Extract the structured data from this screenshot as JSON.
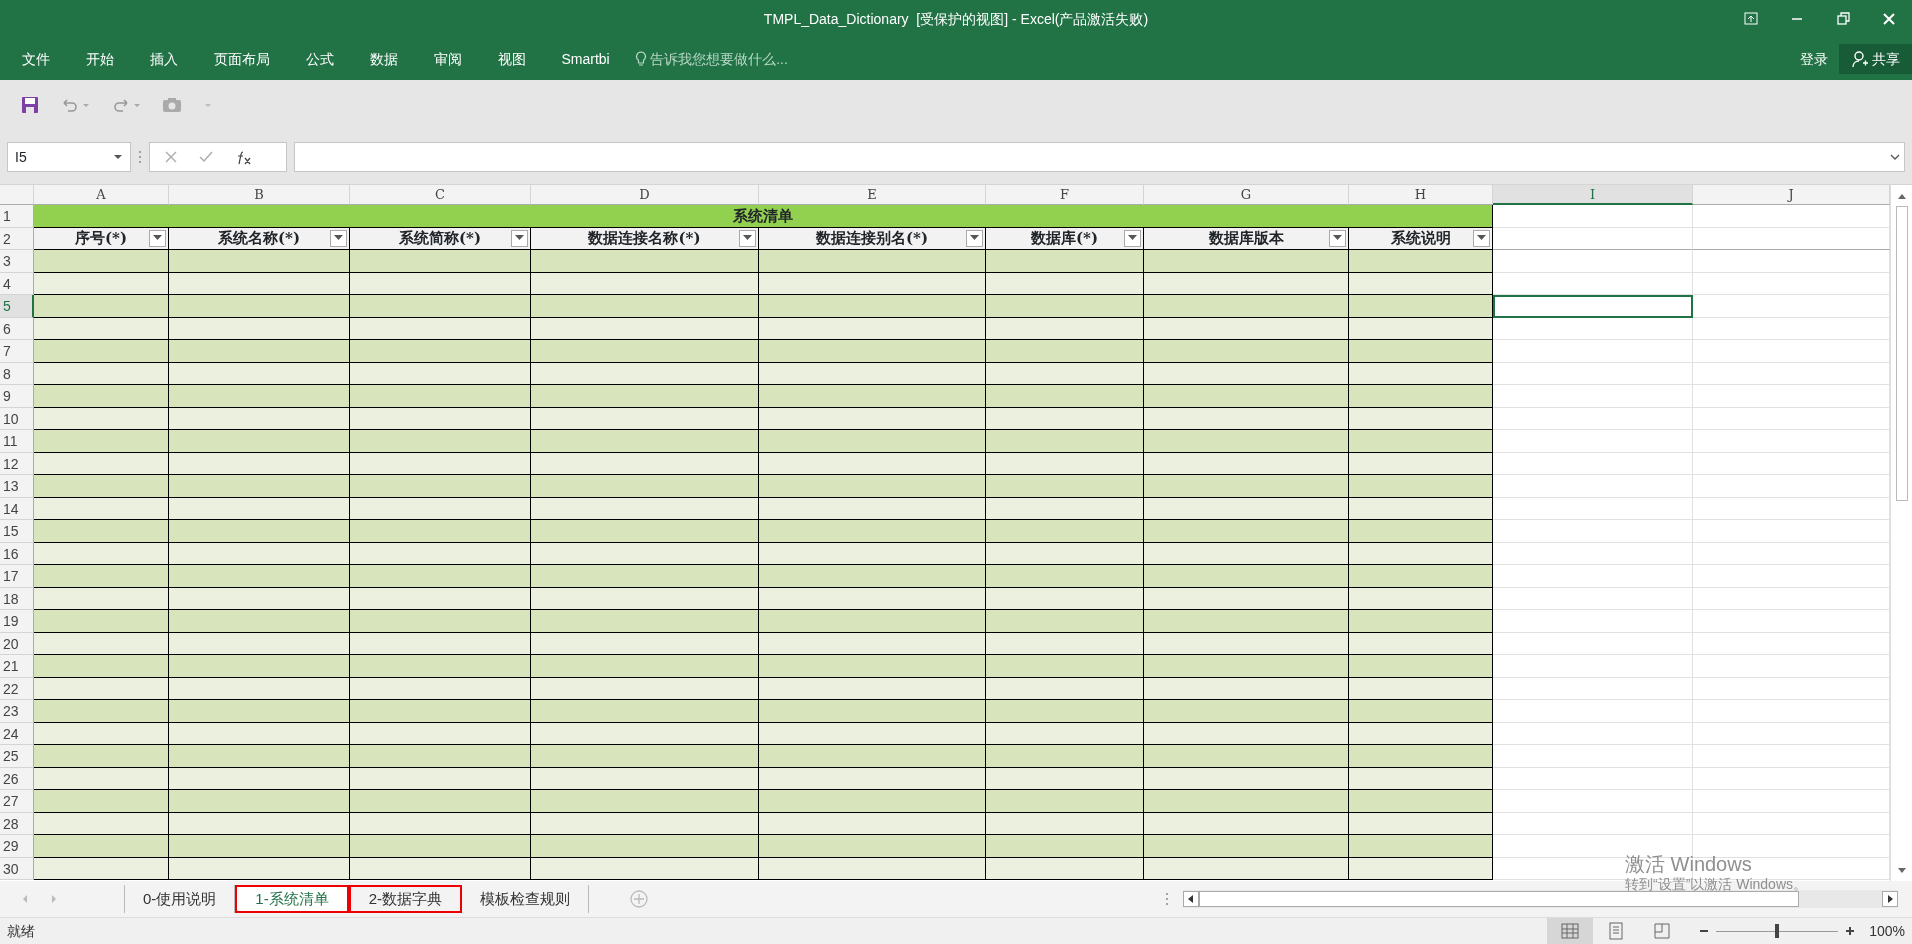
{
  "window": {
    "title": "TMPL_Data_Dictionary  [受保护的视图] - Excel(产品激活失败)"
  },
  "ribbon_tabs": [
    "文件",
    "开始",
    "插入",
    "页面布局",
    "公式",
    "数据",
    "审阅",
    "视图",
    "Smartbi"
  ],
  "tell_me": {
    "placeholder": "告诉我您想要做什么..."
  },
  "sign_in": "登录",
  "share": "共享",
  "name_box": {
    "value": "I5"
  },
  "columns": [
    {
      "label": "A",
      "selected": false
    },
    {
      "label": "B",
      "selected": false
    },
    {
      "label": "C",
      "selected": false
    },
    {
      "label": "D",
      "selected": false
    },
    {
      "label": "E",
      "selected": false
    },
    {
      "label": "F",
      "selected": false
    },
    {
      "label": "G",
      "selected": false
    },
    {
      "label": "H",
      "selected": false
    },
    {
      "label": "I",
      "selected": true
    },
    {
      "label": "J",
      "selected": false
    }
  ],
  "rows": [
    {
      "label": "1",
      "selected": false
    },
    {
      "label": "2",
      "selected": false
    },
    {
      "label": "3",
      "selected": false
    },
    {
      "label": "4",
      "selected": false
    },
    {
      "label": "5",
      "selected": true
    },
    {
      "label": "6",
      "selected": false
    },
    {
      "label": "7",
      "selected": false
    },
    {
      "label": "8",
      "selected": false
    },
    {
      "label": "9",
      "selected": false
    },
    {
      "label": "10",
      "selected": false
    },
    {
      "label": "11",
      "selected": false
    },
    {
      "label": "12",
      "selected": false
    },
    {
      "label": "13",
      "selected": false
    },
    {
      "label": "14",
      "selected": false
    },
    {
      "label": "15",
      "selected": false
    },
    {
      "label": "16",
      "selected": false
    },
    {
      "label": "17",
      "selected": false
    },
    {
      "label": "18",
      "selected": false
    },
    {
      "label": "19",
      "selected": false
    },
    {
      "label": "20",
      "selected": false
    },
    {
      "label": "21",
      "selected": false
    },
    {
      "label": "22",
      "selected": false
    },
    {
      "label": "23",
      "selected": false
    },
    {
      "label": "24",
      "selected": false
    },
    {
      "label": "25",
      "selected": false
    },
    {
      "label": "26",
      "selected": false
    },
    {
      "label": "27",
      "selected": false
    },
    {
      "label": "28",
      "selected": false
    },
    {
      "label": "29",
      "selected": false
    },
    {
      "label": "30",
      "selected": false
    }
  ],
  "table": {
    "title": "系统清单",
    "headers": [
      "序号(*)",
      "系统名称(*)",
      "系统简称(*)",
      "数据连接名称(*)",
      "数据连接别名(*)",
      "数据库(*)",
      "数据库版本",
      "系统说明"
    ]
  },
  "sheet_tabs": [
    {
      "label": "0-使用说明",
      "selected": false,
      "highlighted": false
    },
    {
      "label": "1-系统清单",
      "selected": true,
      "highlighted": true
    },
    {
      "label": "2-数据字典",
      "selected": false,
      "highlighted": true
    },
    {
      "label": "模板检查规则",
      "selected": false,
      "highlighted": false
    }
  ],
  "watermark": {
    "title": "激活 Windows",
    "subtitle": "转到“设置”以激活 Windows。"
  },
  "status_bar": {
    "text": "就绪",
    "views": [
      {
        "kind": "normal",
        "selected": true
      },
      {
        "kind": "page_layout",
        "selected": false
      },
      {
        "kind": "page_break",
        "selected": false
      }
    ],
    "zoom": {
      "level": 0.5,
      "reading": "100%"
    }
  }
}
